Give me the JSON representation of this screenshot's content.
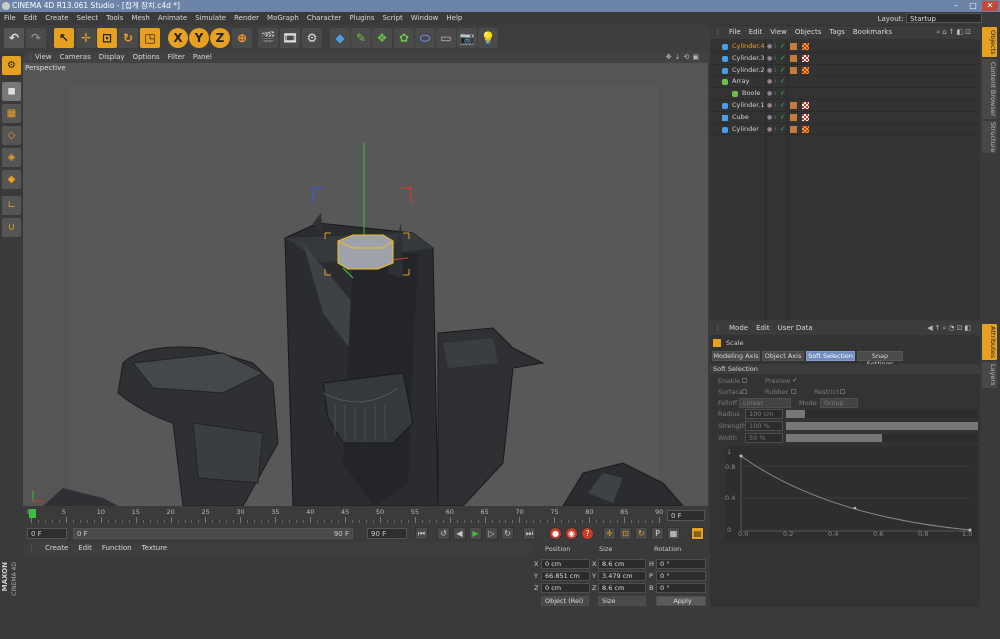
{
  "window": {
    "title": "CINEMA 4D R13.061 Studio - [접게 장치.c4d *]",
    "minimize": "–",
    "maximize": "□",
    "close": "✕"
  },
  "menu": [
    "File",
    "Edit",
    "Create",
    "Select",
    "Tools",
    "Mesh",
    "Animate",
    "Simulate",
    "Render",
    "MoGraph",
    "Character",
    "Plugins",
    "Script",
    "Window",
    "Help"
  ],
  "layout": {
    "label": "Layout:",
    "value": "Startup"
  },
  "viewport": {
    "menu": [
      "View",
      "Cameras",
      "Display",
      "Options",
      "Filter",
      "Panel"
    ],
    "label": "Perspective"
  },
  "timeline": {
    "ticks": [
      "0",
      "5",
      "10",
      "15",
      "20",
      "25",
      "30",
      "35",
      "40",
      "45",
      "50",
      "55",
      "60",
      "65",
      "70",
      "75",
      "80",
      "85",
      "90"
    ],
    "current_frame": "0 F"
  },
  "transport": {
    "start_frame": "0 F",
    "range_start": "0 F",
    "range_end": "90 F",
    "end_frame": "90 F"
  },
  "material": {
    "menu": [
      "Create",
      "Edit",
      "Function",
      "Texture"
    ]
  },
  "coords": {
    "headers": [
      "Position",
      "Size",
      "Rotation"
    ],
    "rows": [
      {
        "axis": "X",
        "pos": "0 cm",
        "size_axis": "X",
        "size": "8.6 cm",
        "rot_axis": "H",
        "rot": "0 °"
      },
      {
        "axis": "Y",
        "pos": "66.851 cm",
        "size_axis": "Y",
        "size": "3.479 cm",
        "rot_axis": "P",
        "rot": "0 °"
      },
      {
        "axis": "Z",
        "pos": "0 cm",
        "size_axis": "Z",
        "size": "8.6 cm",
        "rot_axis": "B",
        "rot": "0 °"
      }
    ],
    "mode": "Object (Rel)",
    "size_mode": "Size",
    "apply": "Apply"
  },
  "objects": {
    "menu": [
      "File",
      "Edit",
      "View",
      "Objects",
      "Tags",
      "Bookmarks"
    ],
    "items": [
      {
        "name": "Cylinder.4",
        "indent": 0,
        "selected": true,
        "icon": "cylinder-icon",
        "tags": "phong,checker"
      },
      {
        "name": "Cylinder.3",
        "indent": 0,
        "selected": false,
        "icon": "cylinder-icon",
        "tags": "phong,material"
      },
      {
        "name": "Cylinder.2",
        "indent": 0,
        "selected": false,
        "icon": "cylinder-icon",
        "tags": "phong,checker"
      },
      {
        "name": "Array",
        "indent": 0,
        "selected": false,
        "icon": "array-icon",
        "tags": ""
      },
      {
        "name": "Boole",
        "indent": 1,
        "selected": false,
        "icon": "boole-icon",
        "tags": ""
      },
      {
        "name": "Cylinder.1",
        "indent": 0,
        "selected": false,
        "icon": "cylinder-icon",
        "tags": "phong,material"
      },
      {
        "name": "Cube",
        "indent": 0,
        "selected": false,
        "icon": "cube-icon",
        "tags": "phong,material"
      },
      {
        "name": "Cylinder",
        "indent": 0,
        "selected": false,
        "icon": "cylinder-icon",
        "tags": "phong,checker"
      }
    ]
  },
  "attributes": {
    "menu": [
      "Mode",
      "Edit",
      "User Data"
    ],
    "tool_name": "Scale",
    "tabs": [
      "Modeling Axis",
      "Object Axis",
      "Soft Selection",
      "Snap Settings"
    ],
    "active_tab": "Soft Selection",
    "section": "Soft Selection",
    "enable": "Enable",
    "preview": "Preview",
    "surface": "Surface",
    "rubber": "Rubber",
    "restrict": "Restrict",
    "falloff_label": "Falloff",
    "falloff_value": "Linear",
    "mode_label": "Mode",
    "mode_value": "Group",
    "radius_label": "Radius",
    "radius_value": "100 cm",
    "radius_level": 0.1,
    "strength_label": "Strength",
    "strength_value": "100 %",
    "strength_level": 1.0,
    "width_label": "Width",
    "width_value": "50 %",
    "width_level": 0.5,
    "graph_y_ticks": [
      "1",
      "0.8",
      "0.4",
      "0"
    ],
    "graph_x_ticks": [
      "0.0",
      "0.2",
      "0.4",
      "0.6",
      "0.8",
      "1.0"
    ]
  },
  "right_tabs": [
    "Objects",
    "Content Browser",
    "Structure",
    "Attributes",
    "Layers"
  ],
  "logo": {
    "brand": "MAXON",
    "product": "CINEMA 4D"
  }
}
